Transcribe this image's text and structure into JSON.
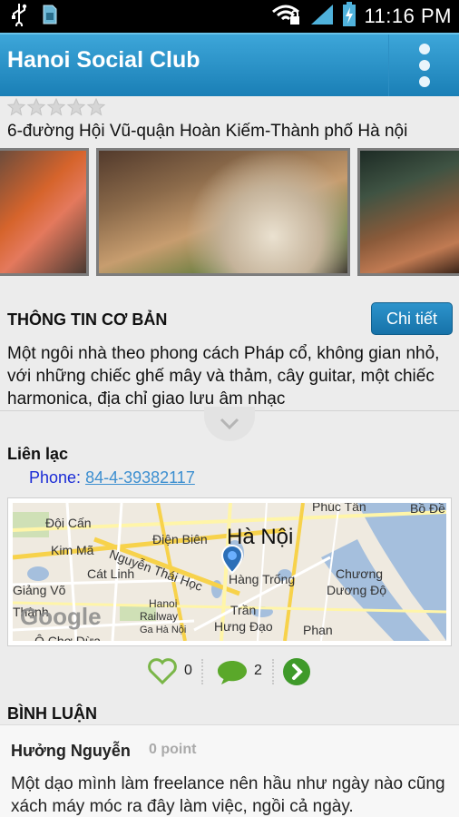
{
  "status_bar": {
    "time": "11:16 PM",
    "left_icons": [
      "usb-icon",
      "sd-card-icon"
    ],
    "right_icons": [
      "wifi-locked-icon",
      "signal-icon",
      "battery-charging-icon"
    ]
  },
  "app_bar": {
    "title": "Hanoi Social Club",
    "menu_icon": "overflow-menu-icon",
    "background": "#1a7fb6"
  },
  "venue": {
    "rating": 0,
    "rating_max": 5,
    "address": "6-đường Hội Vũ-quận Hoàn Kiếm-Thành phố Hà nội",
    "photo_count_visible": 3
  },
  "info_section": {
    "title": "THÔNG TIN CƠ BẢN",
    "detail_button": "Chi tiết",
    "description": "Một ngôi nhà theo phong cách Pháp cổ, không gian nhỏ, với những chiếc ghế mây và thảm, cây guitar, một chiếc harmonica, địa chỉ giao lưu âm nhạc"
  },
  "contact": {
    "title": "Liên lạc",
    "phone_label": "Phone: ",
    "phone_value": "84-4-39382117"
  },
  "map": {
    "labels": {
      "city": "Hà Nội",
      "dien_bien": "Điện Biên",
      "doi_can": "Đội Cấn",
      "kim_ma": "Kim Mã",
      "cat_linh": "Cát Linh",
      "nguyen_thai_hoc": "Nguyễn Thái Học",
      "giang_vo": "Giảng Võ",
      "hang_trong": "Hàng Trống",
      "chuong_duong_1": "Chương",
      "chuong_duong_2": "Dương Độ",
      "hanoi_railway_1": "Hanoi",
      "hanoi_railway_2": "Railway",
      "ga_ha_noi": "Ga Hà Nội",
      "tran_hung_dao_1": "Trần",
      "tran_hung_dao_2": "Hưng Đạo",
      "phan": "Phan",
      "phuc_tan": "Phúc Tân",
      "bo_de": "Bồ Đề",
      "o_cho_dua": "Ô Chợ Dừa",
      "google": "Google",
      "thanh": "Thành"
    }
  },
  "actions": {
    "likes": "0",
    "comments": "2"
  },
  "comments_section": {
    "title": "BÌNH LUẬN",
    "items": [
      {
        "author": "Hưởng Nguyễn",
        "points": "0 point",
        "text": "Một dạo mình làm freelance nên hầu như ngày nào cũng xách máy móc ra đây làm việc, ngồi cả ngày."
      }
    ]
  },
  "colors": {
    "accent": "#1a7fb6",
    "green_action": "#5aa82a",
    "link": "#3d8fd0"
  }
}
